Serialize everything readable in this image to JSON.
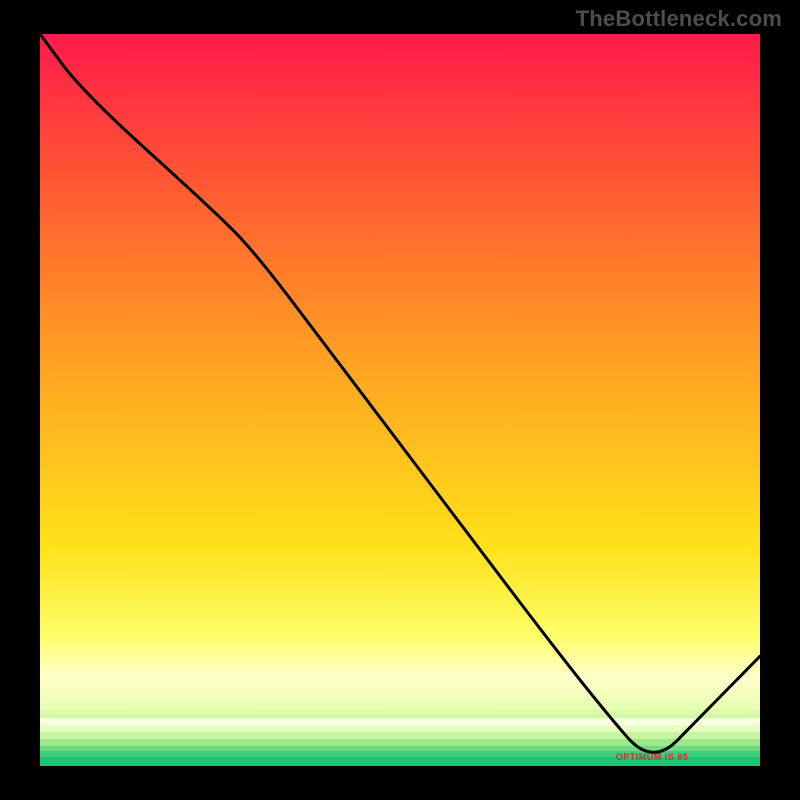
{
  "attribution": "TheBottleneck.com",
  "marker_label": "OPTIMUM IS 85",
  "colors": {
    "black": "#000000",
    "line": "#000000",
    "marker_text": "#cf3030"
  },
  "chart_data": {
    "type": "line",
    "title": "",
    "xlabel": "",
    "ylabel": "",
    "xlim": [
      0,
      100
    ],
    "ylim": [
      0,
      100
    ],
    "grid": false,
    "legend": false,
    "series": [
      {
        "name": "bottleneck-curve",
        "x": [
          0,
          6,
          24,
          30,
          40,
          50,
          60,
          70,
          78,
          85,
          92,
          100
        ],
        "y": [
          100,
          92,
          76,
          70,
          57,
          44,
          31,
          18,
          8,
          0,
          7,
          15
        ]
      }
    ],
    "optimum_x": 85,
    "background_gradient": {
      "description": "vertical gradient from red (top) through orange, yellow, pale-yellow to green near bottom, plotted area only",
      "stops": [
        {
          "pos": 0.0,
          "color": "#ff1a4b"
        },
        {
          "pos": 0.2,
          "color": "#ff5733"
        },
        {
          "pos": 0.45,
          "color": "#ffa322"
        },
        {
          "pos": 0.7,
          "color": "#ffe11a"
        },
        {
          "pos": 0.82,
          "color": "#ffff66"
        },
        {
          "pos": 0.88,
          "color": "#ffffcc"
        },
        {
          "pos": 0.92,
          "color": "#e8ffb0"
        },
        {
          "pos": 0.955,
          "color": "#a0f090"
        },
        {
          "pos": 0.975,
          "color": "#4cd980"
        },
        {
          "pos": 1.0,
          "color": "#11c76f"
        }
      ]
    },
    "bottom_bands": [
      {
        "color": "#f8ffe0",
        "height_frac": 0.01
      },
      {
        "color": "#e6ffc0",
        "height_frac": 0.01
      },
      {
        "color": "#c8f5a0",
        "height_frac": 0.009
      },
      {
        "color": "#9de88a",
        "height_frac": 0.009
      },
      {
        "color": "#6cda82",
        "height_frac": 0.008
      },
      {
        "color": "#3ecf7d",
        "height_frac": 0.008
      },
      {
        "color": "#18c673",
        "height_frac": 0.012
      }
    ]
  }
}
